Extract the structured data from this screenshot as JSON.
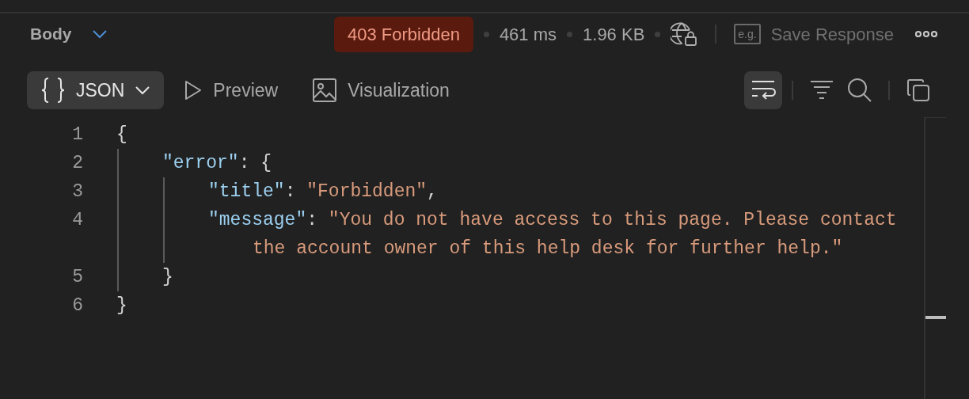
{
  "header": {
    "section": "Body",
    "status": "403 Forbidden",
    "time": "461 ms",
    "size": "1.96 KB",
    "save_icon_text": "e.g.",
    "save_response": "Save Response"
  },
  "view_tabs": [
    {
      "label": "JSON",
      "kind": "json",
      "selected": true
    },
    {
      "label": "Preview",
      "kind": "preview",
      "selected": false
    },
    {
      "label": "Visualization",
      "kind": "visualization",
      "selected": false
    }
  ],
  "tools": [
    {
      "kind": "wrap",
      "selected": true
    },
    {
      "kind": "filter",
      "selected": false
    },
    {
      "kind": "search",
      "selected": false
    },
    {
      "kind": "copy",
      "selected": false
    }
  ],
  "code": [
    {
      "number": "1",
      "kind": "open",
      "tokens": [
        {
          "kind": "punct",
          "text": "{"
        }
      ]
    },
    {
      "number": "2",
      "kind": "open",
      "tokens": [
        {
          "kind": "key",
          "text": "\"error\""
        },
        {
          "kind": "punct",
          "text": ": {"
        }
      ]
    },
    {
      "number": "3",
      "kind": "plain",
      "tokens": [
        {
          "kind": "key",
          "text": "\"title\""
        },
        {
          "kind": "punct",
          "text": ": "
        },
        {
          "kind": "string",
          "text": "\"Forbidden\""
        },
        {
          "kind": "punct",
          "text": ","
        }
      ]
    },
    {
      "number": "4",
      "kind": "plain",
      "tokens": [
        {
          "kind": "key",
          "text": "\"message\""
        },
        {
          "kind": "punct",
          "text": ": "
        },
        {
          "kind": "string",
          "text": "\"You do not have access to this page. Please contact the account owner of this help desk for further help.\""
        }
      ]
    },
    {
      "number": "5",
      "kind": "close",
      "tokens": [
        {
          "kind": "punct",
          "text": "}"
        }
      ]
    },
    {
      "number": "6",
      "kind": "close",
      "tokens": [
        {
          "kind": "punct",
          "text": "}"
        }
      ]
    }
  ]
}
